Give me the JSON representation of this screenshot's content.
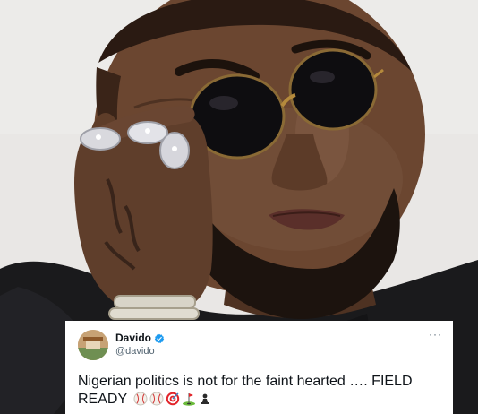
{
  "tweet": {
    "display_name": "Davido",
    "handle": "@davido",
    "text": "Nigerian politics is not for the faint hearted …. FIELD READY",
    "more_glyph": "···",
    "emojis": [
      "baseball-emoji",
      "baseball-emoji",
      "bullseye-emoji",
      "flag-in-hole-emoji",
      "chess-pawn-emoji"
    ],
    "verified": true
  },
  "photo": {
    "subject": "man-with-round-sunglasses",
    "accessories": [
      "round-dark-sunglasses",
      "diamond-rings",
      "wrist-bracelets",
      "hand-tattoo"
    ]
  },
  "colors": {
    "background": "#e8e6e4",
    "skin": "#6b4630",
    "jacket": "#1a1a1c",
    "verified_blue": "#1d9bf0",
    "text_primary": "#0f1419",
    "text_secondary": "#536471"
  }
}
